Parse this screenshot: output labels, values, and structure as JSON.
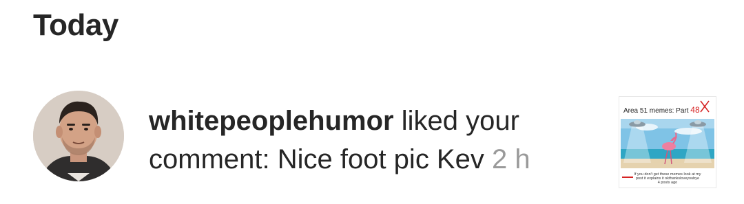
{
  "section": {
    "title": "Today"
  },
  "notification": {
    "username": "whitepeoplehumor",
    "action": " liked your comment: Nice foot pic Kev ",
    "time": "2 h",
    "thumbnail": {
      "title": "Area 51 memes: Part",
      "part_number": "48",
      "caption_line1": "If you don't get these memes look at my",
      "caption_line2": "post it explains it okthanksloveyoubye",
      "caption_line3": "4 posts ago"
    }
  },
  "colors": {
    "text": "#262626",
    "timestamp": "#9a9a9a",
    "annotation_red": "#d62424"
  }
}
